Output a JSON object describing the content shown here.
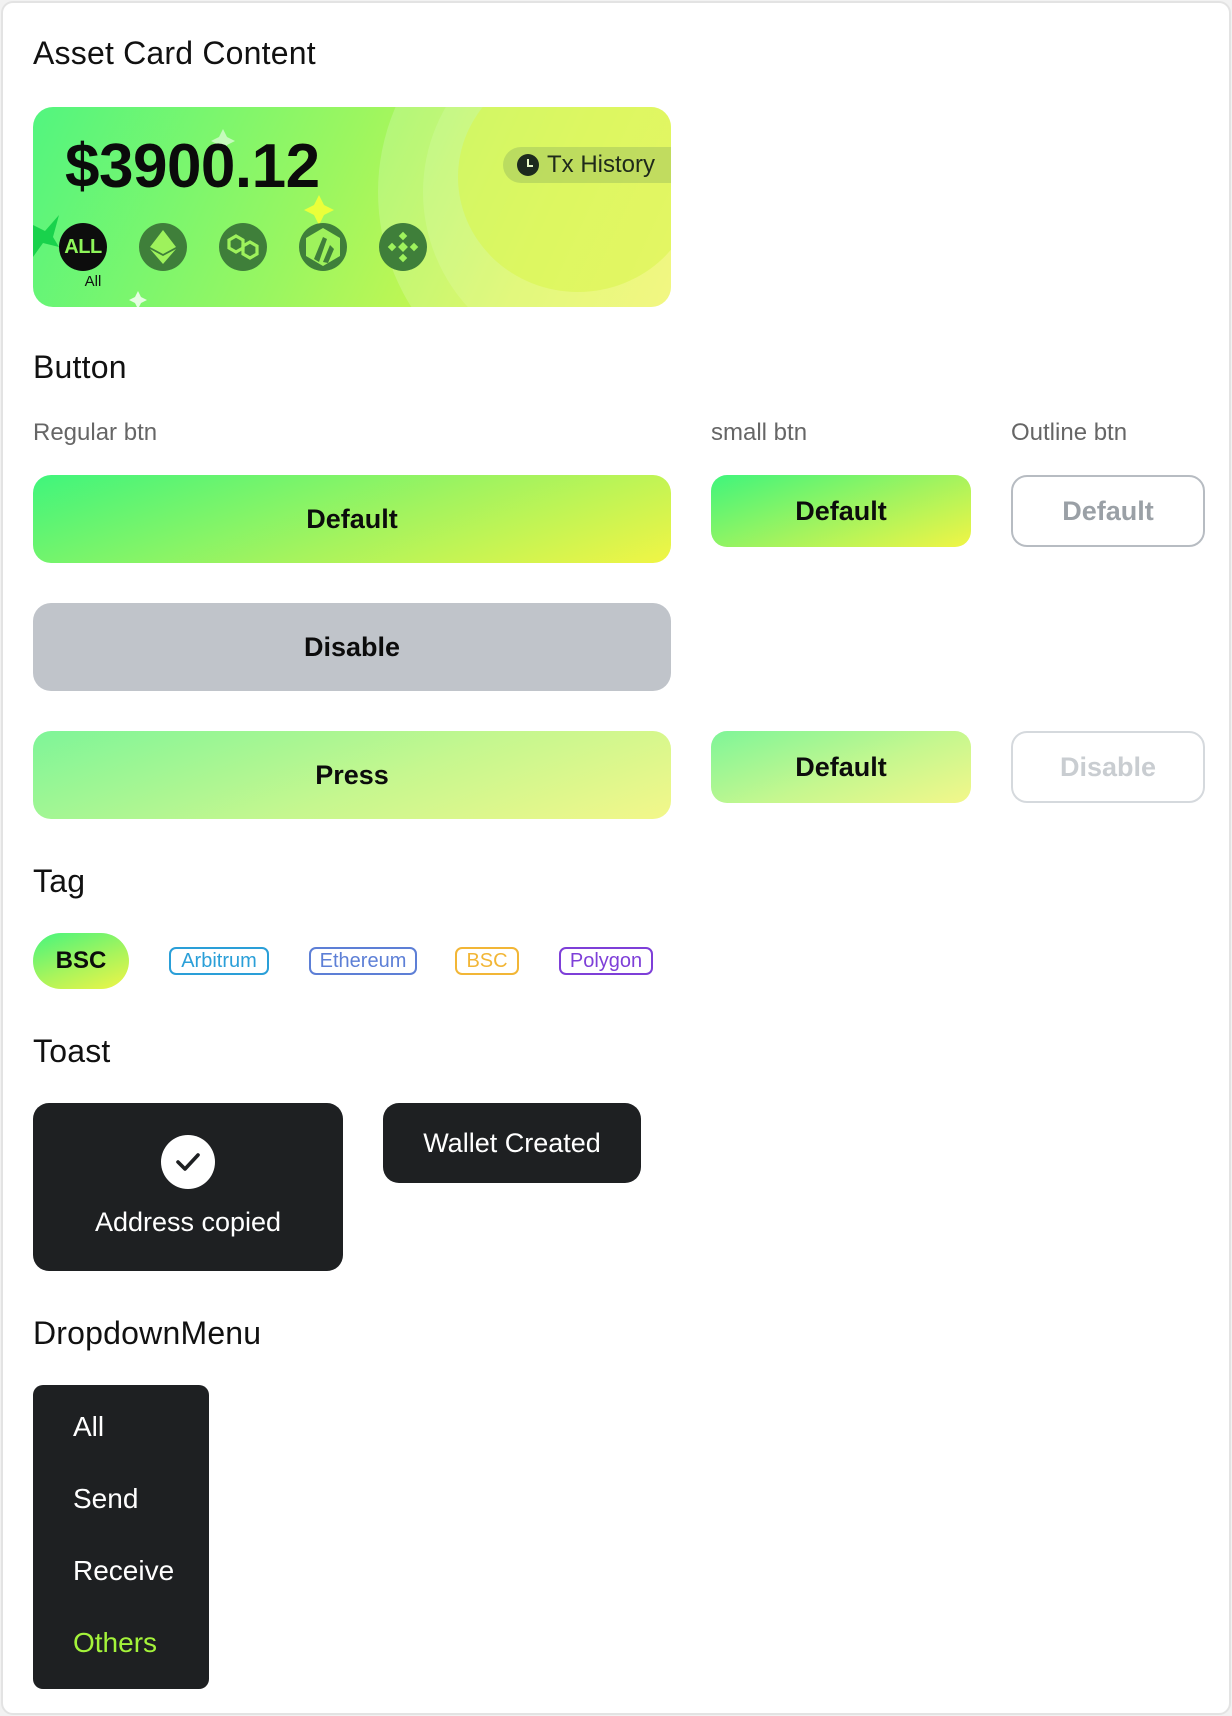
{
  "sections": {
    "asset_card": "Asset Card Content",
    "button": "Button",
    "tag": "Tag",
    "toast": "Toast",
    "dropdown": "DropdownMenu"
  },
  "asset_card": {
    "balance": "$3900.12",
    "tx_history_label": "Tx History",
    "chains": [
      {
        "icon": "all-chains-icon",
        "text": "ALL",
        "label": "All",
        "selected": true
      },
      {
        "icon": "ethereum-icon"
      },
      {
        "icon": "polygon-icon"
      },
      {
        "icon": "arbitrum-icon"
      },
      {
        "icon": "bnb-icon"
      }
    ]
  },
  "buttons": {
    "regular_label": "Regular btn",
    "small_label": "small btn",
    "outline_label": "Outline btn",
    "regular_default": "Default",
    "regular_disable": "Disable",
    "regular_press": "Press",
    "small_default": "Default",
    "small_press": "Default",
    "outline_default": "Default",
    "outline_disable": "Disable"
  },
  "tags": {
    "selected": "BSC",
    "items": [
      {
        "label": "Arbitrum",
        "color": "#2a9fd8"
      },
      {
        "label": "Ethereum",
        "color": "#5d7fd6"
      },
      {
        "label": "BSC",
        "color": "#f2b636"
      },
      {
        "label": "Polygon",
        "color": "#7e3fd8"
      }
    ]
  },
  "toasts": {
    "address_copied": "Address copied",
    "wallet_created": "Wallet Created"
  },
  "dropdown": {
    "items": [
      "All",
      "Send",
      "Receive",
      "Others"
    ],
    "active_index": 3,
    "active_color": "#a4f33a"
  },
  "colors": {
    "brand_green": "#3ff57c",
    "brand_yellow": "#f1f545",
    "dark_surface": "#1e2022",
    "disabled_gray": "#c0c4ca"
  }
}
